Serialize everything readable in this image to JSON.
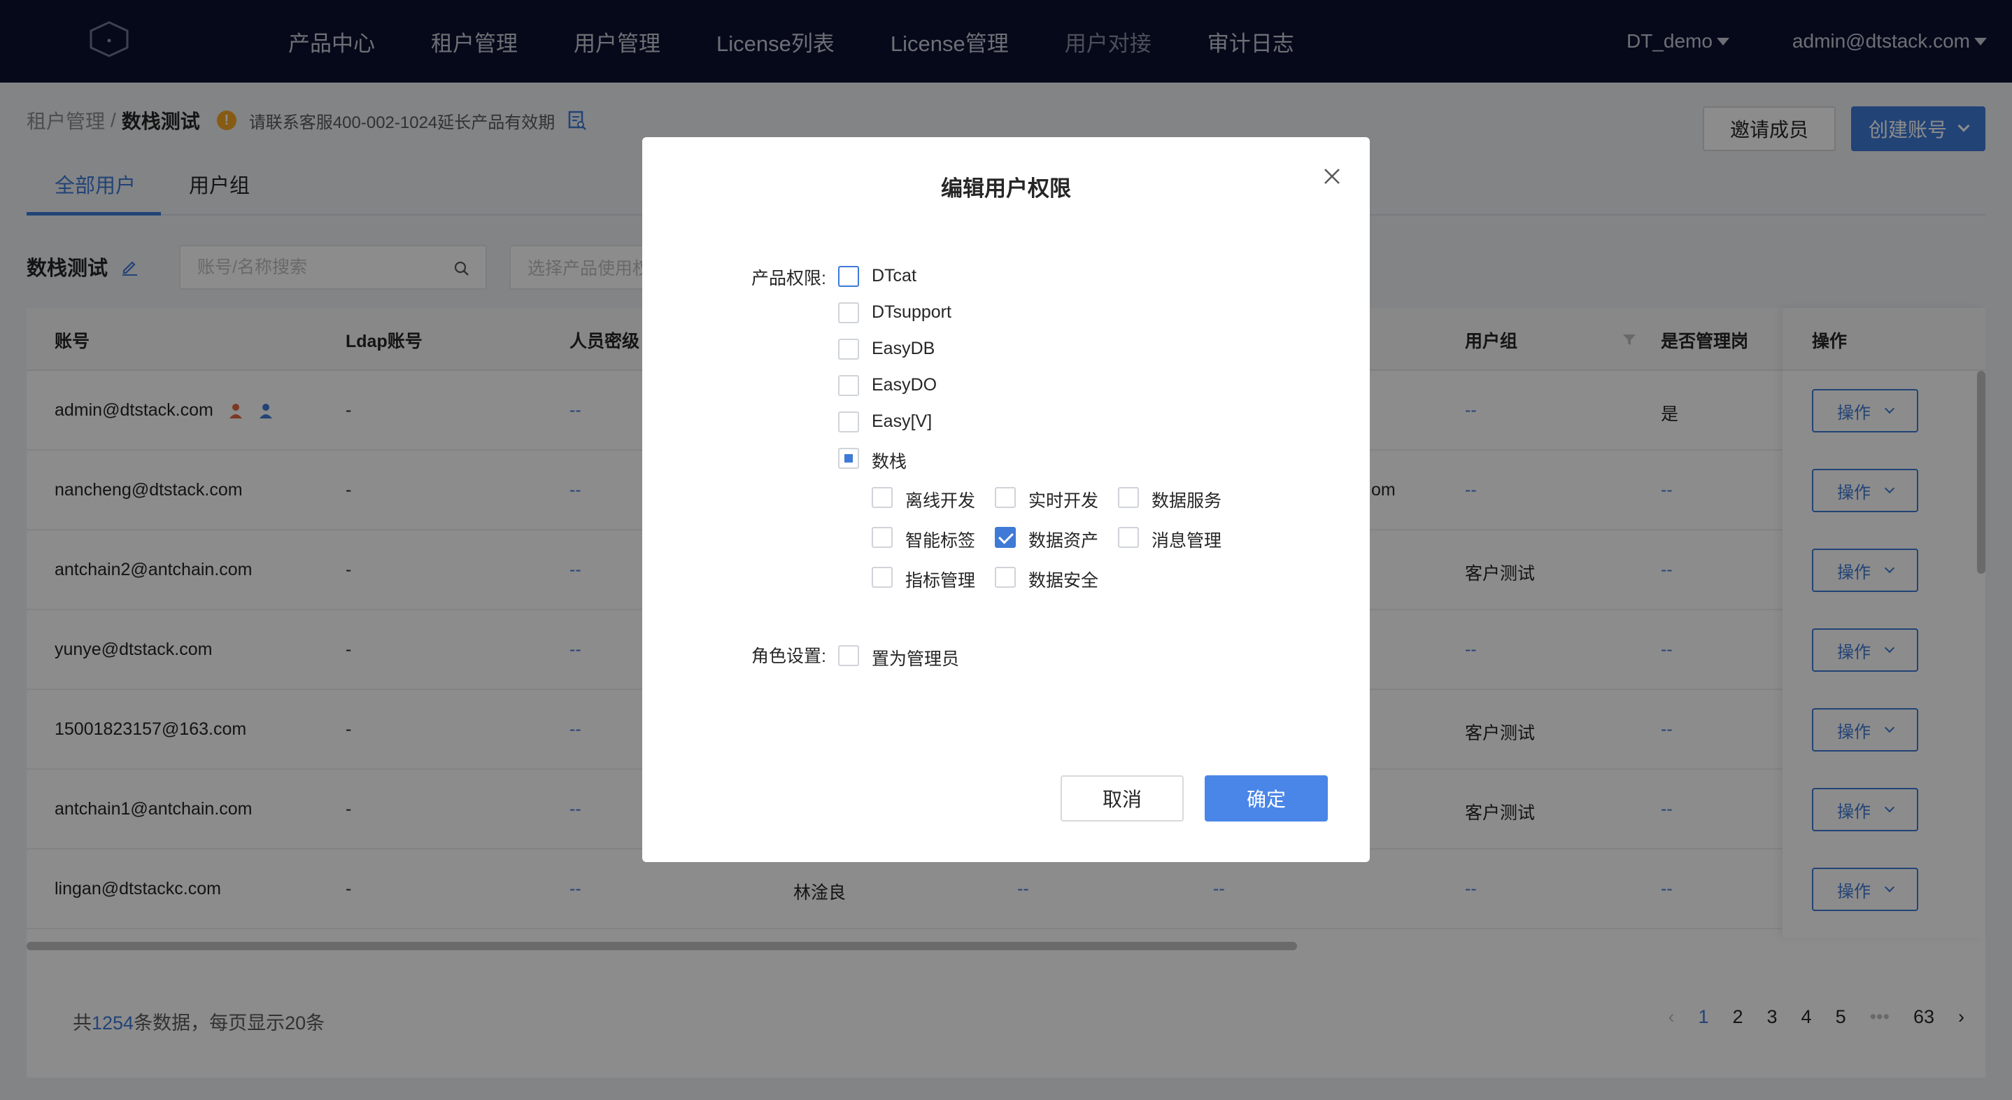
{
  "nav": {
    "items": [
      "产品中心",
      "租户管理",
      "用户管理",
      "License列表",
      "License管理",
      "用户对接",
      "审计日志"
    ],
    "tenant": "DT_demo",
    "user": "admin@dtstack.com"
  },
  "header": {
    "breadcrumb_parent": "租户管理",
    "breadcrumb_sep": "/",
    "breadcrumb_current": "数栈测试",
    "warning_icon": "!",
    "warning_text": "请联系客服400-002-1024延长产品有效期",
    "invite_label": "邀请成员",
    "create_label": "创建账号"
  },
  "tabs": [
    "全部用户",
    "用户组"
  ],
  "filters": {
    "group_name": "数栈测试",
    "search_placeholder": "账号/名称搜索",
    "select_placeholder": "选择产品使用权"
  },
  "table": {
    "headers": {
      "account": "账号",
      "ldap": "Ldap账号",
      "level": "人员密级",
      "group": "用户组",
      "is_admin": "是否管理岗",
      "action": "操作"
    },
    "rows": [
      {
        "account": "admin@dtstack.com",
        "ldap": "-",
        "level": "--",
        "name": "",
        "mid": "",
        "group": "--",
        "is_admin": "是",
        "action": "操作"
      },
      {
        "account": "nancheng@dtstack.com",
        "ldap": "-",
        "level": "--",
        "name": "",
        "mid": "om",
        "group": "--",
        "is_admin": "--",
        "action": "操作"
      },
      {
        "account": "antchain2@antchain.com",
        "ldap": "-",
        "level": "--",
        "name": "",
        "mid": "",
        "group": "客户测试",
        "is_admin": "--",
        "action": "操作"
      },
      {
        "account": "yunye@dtstack.com",
        "ldap": "-",
        "level": "--",
        "name": "",
        "mid": "",
        "group": "--",
        "is_admin": "--",
        "action": "操作"
      },
      {
        "account": "15001823157@163.com",
        "ldap": "-",
        "level": "--",
        "name": "",
        "mid": "",
        "group": "客户测试",
        "is_admin": "--",
        "action": "操作"
      },
      {
        "account": "antchain1@antchain.com",
        "ldap": "-",
        "level": "--",
        "name": "",
        "mid": "",
        "group": "客户测试",
        "is_admin": "--",
        "action": "操作"
      },
      {
        "account": "lingan@dtstackc.com",
        "ldap": "-",
        "level": "--",
        "name": "林淦良",
        "mid": "--",
        "mid2": "--",
        "group": "--",
        "is_admin": "--",
        "action": "操作"
      }
    ]
  },
  "footer": {
    "total_prefix": "共",
    "total_count": "1254",
    "total_suffix": "条数据，每页显示20条",
    "pages": [
      "1",
      "2",
      "3",
      "4",
      "5",
      "•••",
      "63"
    ],
    "prev": "‹",
    "next": "›"
  },
  "modal": {
    "title": "编辑用户权限",
    "product_label": "产品权限:",
    "products": [
      {
        "name": "DTcat",
        "state": "unchecked"
      },
      {
        "name": "DTsupport",
        "state": "unchecked"
      },
      {
        "name": "EasyDB",
        "state": "unchecked"
      },
      {
        "name": "EasyDO",
        "state": "unchecked"
      },
      {
        "name": "Easy[V]",
        "state": "unchecked"
      },
      {
        "name": "数栈",
        "state": "indeterminate"
      }
    ],
    "sub_modules": [
      {
        "name": "离线开发",
        "checked": false
      },
      {
        "name": "实时开发",
        "checked": false
      },
      {
        "name": "数据服务",
        "checked": false
      },
      {
        "name": "智能标签",
        "checked": false
      },
      {
        "name": "数据资产",
        "checked": true
      },
      {
        "name": "消息管理",
        "checked": false
      },
      {
        "name": "指标管理",
        "checked": false
      },
      {
        "name": "数据安全",
        "checked": false
      }
    ],
    "role_label": "角色设置:",
    "role_option": "置为管理员",
    "cancel_label": "取消",
    "ok_label": "确定"
  },
  "colors": {
    "nav_bg": "#0b1131",
    "primary": "#3f7ad7",
    "warning": "#f5a623"
  }
}
